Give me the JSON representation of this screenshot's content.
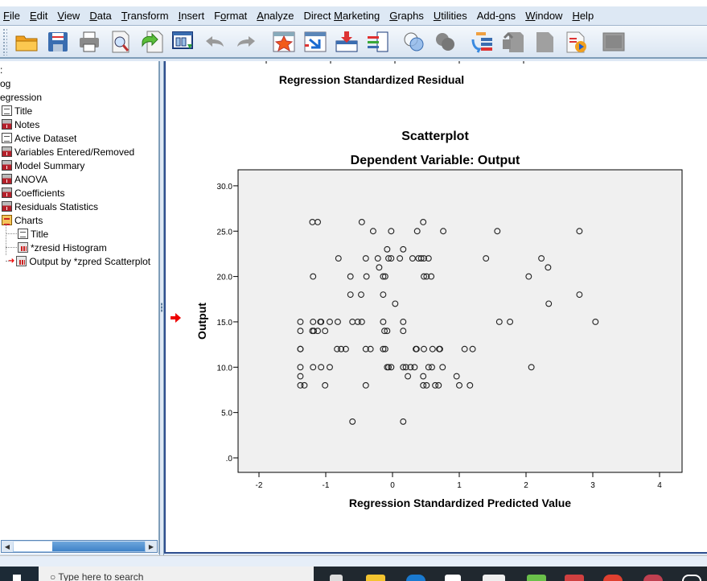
{
  "menubar": {
    "items": [
      {
        "label": "File",
        "u": "F"
      },
      {
        "label": "Edit",
        "u": "E"
      },
      {
        "label": "View",
        "u": "V"
      },
      {
        "label": "Data",
        "u": "D"
      },
      {
        "label": "Transform",
        "u": "T"
      },
      {
        "label": "Insert",
        "u": "I"
      },
      {
        "label": "Format",
        "u": "o"
      },
      {
        "label": "Analyze",
        "u": "A"
      },
      {
        "label": "Direct Marketing",
        "u": "M"
      },
      {
        "label": "Graphs",
        "u": "G"
      },
      {
        "label": "Utilities",
        "u": "U"
      },
      {
        "label": "Add-ons",
        "u": "o"
      },
      {
        "label": "Window",
        "u": "W"
      },
      {
        "label": "Help",
        "u": "H"
      }
    ]
  },
  "toolbar": {
    "buttons": [
      "open-folder",
      "save",
      "print",
      "print-preview",
      "export",
      "recall-dialog",
      "undo",
      "redo",
      "goto-data",
      "goto-case",
      "goto-variable",
      "variables",
      "show-all",
      "hide",
      "designate-window",
      "promote",
      "demote",
      "insert-output",
      "collapse"
    ]
  },
  "outline": {
    "items": [
      {
        "label": ":",
        "level": 0,
        "icon": "none"
      },
      {
        "label": "og",
        "level": 0,
        "icon": "none"
      },
      {
        "label": "egression",
        "level": 0,
        "icon": "none"
      },
      {
        "label": "Title",
        "level": 1,
        "icon": "doc"
      },
      {
        "label": "Notes",
        "level": 1,
        "icon": "tbl"
      },
      {
        "label": "Active Dataset",
        "level": 1,
        "icon": "doc"
      },
      {
        "label": "Variables Entered/Removed",
        "level": 1,
        "icon": "tbl"
      },
      {
        "label": "Model Summary",
        "level": 1,
        "icon": "tbl"
      },
      {
        "label": "ANOVA",
        "level": 1,
        "icon": "tbl"
      },
      {
        "label": "Coefficients",
        "level": 1,
        "icon": "tbl"
      },
      {
        "label": "Residuals Statistics",
        "level": 1,
        "icon": "tbl"
      },
      {
        "label": "Charts",
        "level": 1,
        "icon": "charts"
      },
      {
        "label": "Title",
        "level": 2,
        "icon": "doc"
      },
      {
        "label": "*zresid Histogram",
        "level": 2,
        "icon": "chart"
      },
      {
        "label": "Output by *zpred Scatterplot",
        "level": 2,
        "icon": "chart",
        "current": true
      }
    ]
  },
  "content": {
    "prev_chart_xlabel": "Regression Standardized Residual"
  },
  "taskbar": {
    "search_placeholder": "Type here to search"
  },
  "chart_data": {
    "type": "scatter",
    "title": "Scatterplot",
    "subtitle": "Dependent Variable: Output",
    "xlabel": "Regression Standardized Predicted Value",
    "ylabel": "Output",
    "xlim": [
      -2.3,
      4.3
    ],
    "ylim": [
      -1.5,
      31.5
    ],
    "xticks": [
      -2,
      -1,
      0,
      1,
      2,
      3,
      4
    ],
    "xtick_labels": [
      "-2",
      "-1",
      "0",
      "1",
      "2",
      "3",
      "4"
    ],
    "yticks": [
      0,
      5,
      10,
      15,
      20,
      25,
      30
    ],
    "ytick_labels": [
      ".0",
      "5.0",
      "10.0",
      "15.0",
      "20.0",
      "25.0",
      "30.0"
    ],
    "grid": false,
    "marker": "open-circle",
    "points": [
      [
        -1.2,
        26
      ],
      [
        -1.12,
        26
      ],
      [
        -0.46,
        26
      ],
      [
        0.46,
        26
      ],
      [
        -0.29,
        25
      ],
      [
        -0.02,
        25
      ],
      [
        0.37,
        25
      ],
      [
        0.76,
        25
      ],
      [
        1.57,
        25
      ],
      [
        2.8,
        25
      ],
      [
        -0.08,
        23
      ],
      [
        0.16,
        23
      ],
      [
        -0.81,
        22
      ],
      [
        -0.4,
        22
      ],
      [
        -0.22,
        22
      ],
      [
        -0.06,
        22
      ],
      [
        -0.02,
        22
      ],
      [
        0.11,
        22
      ],
      [
        0.3,
        22
      ],
      [
        0.39,
        22
      ],
      [
        0.43,
        22
      ],
      [
        0.47,
        22
      ],
      [
        0.54,
        22
      ],
      [
        1.4,
        22
      ],
      [
        2.23,
        22
      ],
      [
        -0.2,
        21
      ],
      [
        2.33,
        21
      ],
      [
        -1.19,
        20
      ],
      [
        -0.63,
        20
      ],
      [
        -0.39,
        20
      ],
      [
        -0.14,
        20
      ],
      [
        -0.11,
        20
      ],
      [
        0.47,
        20
      ],
      [
        0.51,
        20
      ],
      [
        0.58,
        20
      ],
      [
        2.04,
        20
      ],
      [
        -0.63,
        18
      ],
      [
        -0.47,
        18
      ],
      [
        -0.14,
        18
      ],
      [
        2.8,
        18
      ],
      [
        0.04,
        17
      ],
      [
        2.34,
        17
      ],
      [
        -1.38,
        15
      ],
      [
        -1.19,
        15
      ],
      [
        -1.08,
        15
      ],
      [
        -1.07,
        15
      ],
      [
        -0.94,
        15
      ],
      [
        -0.82,
        15
      ],
      [
        -0.6,
        15
      ],
      [
        -0.52,
        15
      ],
      [
        -0.46,
        15
      ],
      [
        -0.14,
        15
      ],
      [
        0.16,
        15
      ],
      [
        1.6,
        15
      ],
      [
        1.76,
        15
      ],
      [
        3.04,
        15
      ],
      [
        -1.38,
        14
      ],
      [
        -1.2,
        14
      ],
      [
        -1.18,
        14
      ],
      [
        -1.12,
        14
      ],
      [
        -1.01,
        14
      ],
      [
        -0.12,
        14
      ],
      [
        -0.08,
        14
      ],
      [
        0.16,
        14
      ],
      [
        -1.38,
        12
      ],
      [
        -1.38,
        12
      ],
      [
        -0.83,
        12
      ],
      [
        -0.77,
        12
      ],
      [
        -0.7,
        12
      ],
      [
        -0.4,
        12
      ],
      [
        -0.33,
        12
      ],
      [
        -0.14,
        12
      ],
      [
        -0.11,
        12
      ],
      [
        0.35,
        12
      ],
      [
        0.36,
        12
      ],
      [
        0.47,
        12
      ],
      [
        0.6,
        12
      ],
      [
        0.7,
        12
      ],
      [
        0.71,
        12
      ],
      [
        1.08,
        12
      ],
      [
        1.2,
        12
      ],
      [
        -1.38,
        10
      ],
      [
        -1.19,
        10
      ],
      [
        -1.07,
        10
      ],
      [
        -0.94,
        10
      ],
      [
        -0.08,
        10
      ],
      [
        -0.06,
        10
      ],
      [
        -0.02,
        10
      ],
      [
        0.16,
        10
      ],
      [
        0.2,
        10
      ],
      [
        0.27,
        10
      ],
      [
        0.33,
        10
      ],
      [
        0.54,
        10
      ],
      [
        0.59,
        10
      ],
      [
        0.75,
        10
      ],
      [
        2.08,
        10
      ],
      [
        -1.38,
        9
      ],
      [
        0.23,
        9
      ],
      [
        0.46,
        9
      ],
      [
        0.96,
        9
      ],
      [
        -1.38,
        8
      ],
      [
        -1.32,
        8
      ],
      [
        -1.01,
        8
      ],
      [
        -0.4,
        8
      ],
      [
        0.46,
        8
      ],
      [
        0.51,
        8
      ],
      [
        0.64,
        8
      ],
      [
        0.69,
        8
      ],
      [
        1.0,
        8
      ],
      [
        1.16,
        8
      ],
      [
        -0.6,
        4
      ],
      [
        0.16,
        4
      ]
    ]
  }
}
